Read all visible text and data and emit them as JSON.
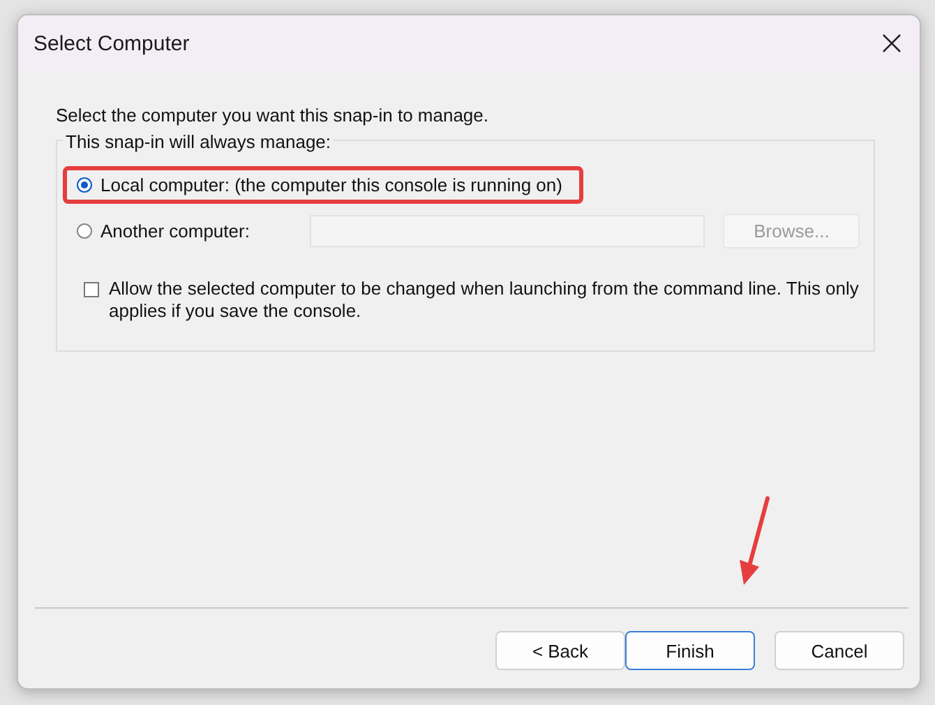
{
  "window": {
    "title": "Select Computer"
  },
  "instruction": "Select the computer you want this snap-in to manage.",
  "group": {
    "label": "This snap-in will always manage:",
    "options": [
      {
        "label": "Local computer:  (the computer this console is running on)",
        "selected": true,
        "highlighted": true
      },
      {
        "label": "Another computer:",
        "selected": false,
        "highlighted": false
      }
    ],
    "browse_button": {
      "label": "Browse...",
      "disabled": true
    },
    "checkbox": {
      "label": "Allow the selected computer to be changed when launching from the command line.  This only applies if you save the console.",
      "checked": false
    }
  },
  "buttons": [
    {
      "label": "< Back",
      "kind": "normal"
    },
    {
      "label": "Finish",
      "kind": "default"
    },
    {
      "label": "Cancel",
      "kind": "normal"
    }
  ]
}
